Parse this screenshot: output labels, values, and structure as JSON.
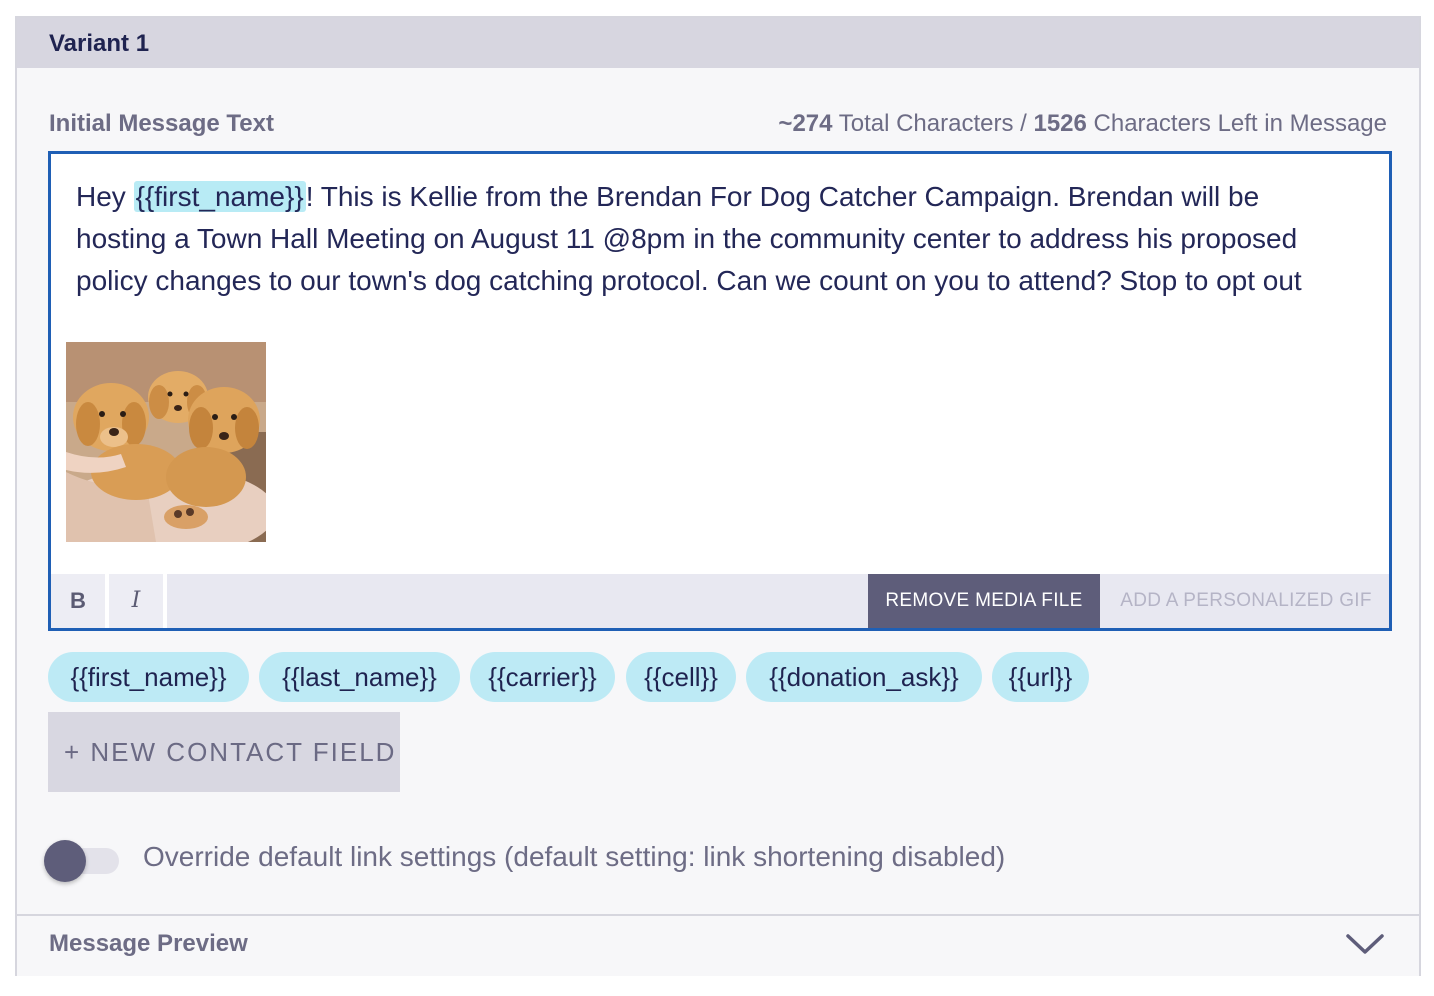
{
  "variant": {
    "title": "Variant 1"
  },
  "message": {
    "label": "Initial Message Text",
    "char_count": {
      "total": "~274",
      "total_label": " Total Characters / ",
      "left": "1526",
      "left_label": " Characters Left in Message"
    },
    "text_before": "Hey ",
    "token": "{{first_name}}",
    "text_after": "! This is Kellie from the Brendan For Dog Catcher Campaign. Brendan will be hosting a Town Hall Meeting on August 11 @8pm in the community center to address his proposed policy changes to our town's dog catching protocol. Can we count on you to attend? Stop to opt out",
    "media_alt": "puppies-photo"
  },
  "toolbar": {
    "bold_label": "B",
    "italic_label": "I",
    "remove_media_label": "REMOVE MEDIA FILE",
    "add_gif_label": "ADD A PERSONALIZED GIF"
  },
  "contact_fields": [
    "{{first_name}}",
    "{{last_name}}",
    "{{carrier}}",
    "{{cell}}",
    "{{donation_ask}}",
    "{{url}}"
  ],
  "new_contact_field_label": "+ NEW CONTACT FIELD",
  "link_override": {
    "enabled": false,
    "label": "Override default link settings (default setting: link shortening disabled)"
  },
  "preview": {
    "label": "Message Preview",
    "icon": "chevron-down-icon"
  },
  "colors": {
    "accent_border": "#1f5fb5",
    "chip_bg": "#bdeaf5",
    "dark_button": "#5e5d7a",
    "header_bg": "#d7d6e0"
  }
}
